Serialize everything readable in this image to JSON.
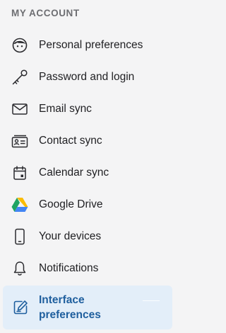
{
  "section": {
    "title": "MY ACCOUNT"
  },
  "items": [
    {
      "label": "Personal preferences",
      "icon": "face-icon"
    },
    {
      "label": "Password and login",
      "icon": "key-icon"
    },
    {
      "label": "Email sync",
      "icon": "envelope-icon"
    },
    {
      "label": "Contact sync",
      "icon": "contact-card-icon"
    },
    {
      "label": "Calendar sync",
      "icon": "calendar-icon"
    },
    {
      "label": "Google Drive",
      "icon": "google-drive-icon"
    },
    {
      "label": "Your devices",
      "icon": "phone-icon"
    },
    {
      "label": "Notifications",
      "icon": "bell-icon"
    }
  ],
  "active_item": {
    "label_line1": "Interface",
    "label_line2": "preferences",
    "icon": "interface-edit-icon"
  },
  "colors": {
    "background": "#f4f4f5",
    "active_bg": "#e3eef9",
    "active_text": "#1f5f9e",
    "text": "#1f1f22",
    "muted": "#6d6e72"
  }
}
